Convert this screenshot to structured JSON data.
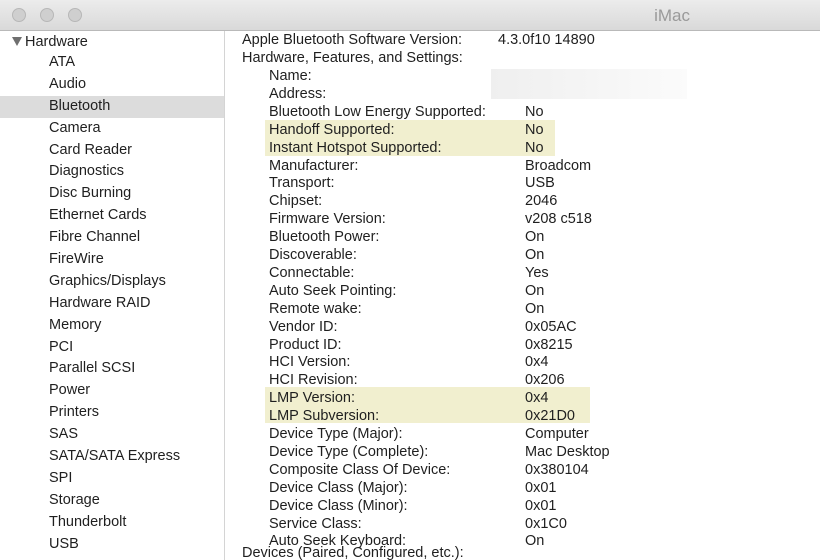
{
  "window": {
    "title": "iMac"
  },
  "sidebar": {
    "section": "Hardware",
    "selected": "Bluetooth",
    "items": [
      "ATA",
      "Audio",
      "Bluetooth",
      "Camera",
      "Card Reader",
      "Diagnostics",
      "Disc Burning",
      "Ethernet Cards",
      "Fibre Channel",
      "FireWire",
      "Graphics/Displays",
      "Hardware RAID",
      "Memory",
      "PCI",
      "Parallel SCSI",
      "Power",
      "Printers",
      "SAS",
      "SATA/SATA Express",
      "SPI",
      "Storage",
      "Thunderbolt",
      "USB"
    ]
  },
  "details": {
    "software_version_label": "Apple Bluetooth Software Version:",
    "software_version_value": "4.3.0f10 14890",
    "section_label": "Hardware, Features, and Settings:",
    "rows": [
      {
        "label": "Name:",
        "value": ""
      },
      {
        "label": "Address:",
        "value": ""
      },
      {
        "label": "Bluetooth Low Energy Supported:",
        "value": "No"
      },
      {
        "label": "Handoff Supported:",
        "value": "No"
      },
      {
        "label": "Instant Hotspot Supported:",
        "value": "No"
      },
      {
        "label": "Manufacturer:",
        "value": "Broadcom"
      },
      {
        "label": "Transport:",
        "value": "USB"
      },
      {
        "label": "Chipset:",
        "value": "2046"
      },
      {
        "label": "Firmware Version:",
        "value": "v208 c518"
      },
      {
        "label": "Bluetooth Power:",
        "value": "On"
      },
      {
        "label": "Discoverable:",
        "value": "On"
      },
      {
        "label": "Connectable:",
        "value": "Yes"
      },
      {
        "label": "Auto Seek Pointing:",
        "value": "On"
      },
      {
        "label": "Remote wake:",
        "value": "On"
      },
      {
        "label": "Vendor ID:",
        "value": "0x05AC"
      },
      {
        "label": "Product ID:",
        "value": "0x8215"
      },
      {
        "label": "HCI Version:",
        "value": "0x4"
      },
      {
        "label": "HCI Revision:",
        "value": "0x206"
      },
      {
        "label": "LMP Version:",
        "value": "0x4"
      },
      {
        "label": "LMP Subversion:",
        "value": "0x21D0"
      },
      {
        "label": "Device Type (Major):",
        "value": "Computer"
      },
      {
        "label": "Device Type (Complete):",
        "value": "Mac Desktop"
      },
      {
        "label": "Composite Class Of Device:",
        "value": "0x380104"
      },
      {
        "label": "Device Class (Major):",
        "value": "0x01"
      },
      {
        "label": "Device Class (Minor):",
        "value": "0x01"
      },
      {
        "label": "Service Class:",
        "value": "0x1C0"
      },
      {
        "label": "Auto Seek Keyboard:",
        "value": "On"
      }
    ],
    "devices_label": "Devices (Paired, Configured, etc.):"
  },
  "colors": {
    "highlight": "#f1efcf",
    "selected_row": "#dcdcdc"
  }
}
